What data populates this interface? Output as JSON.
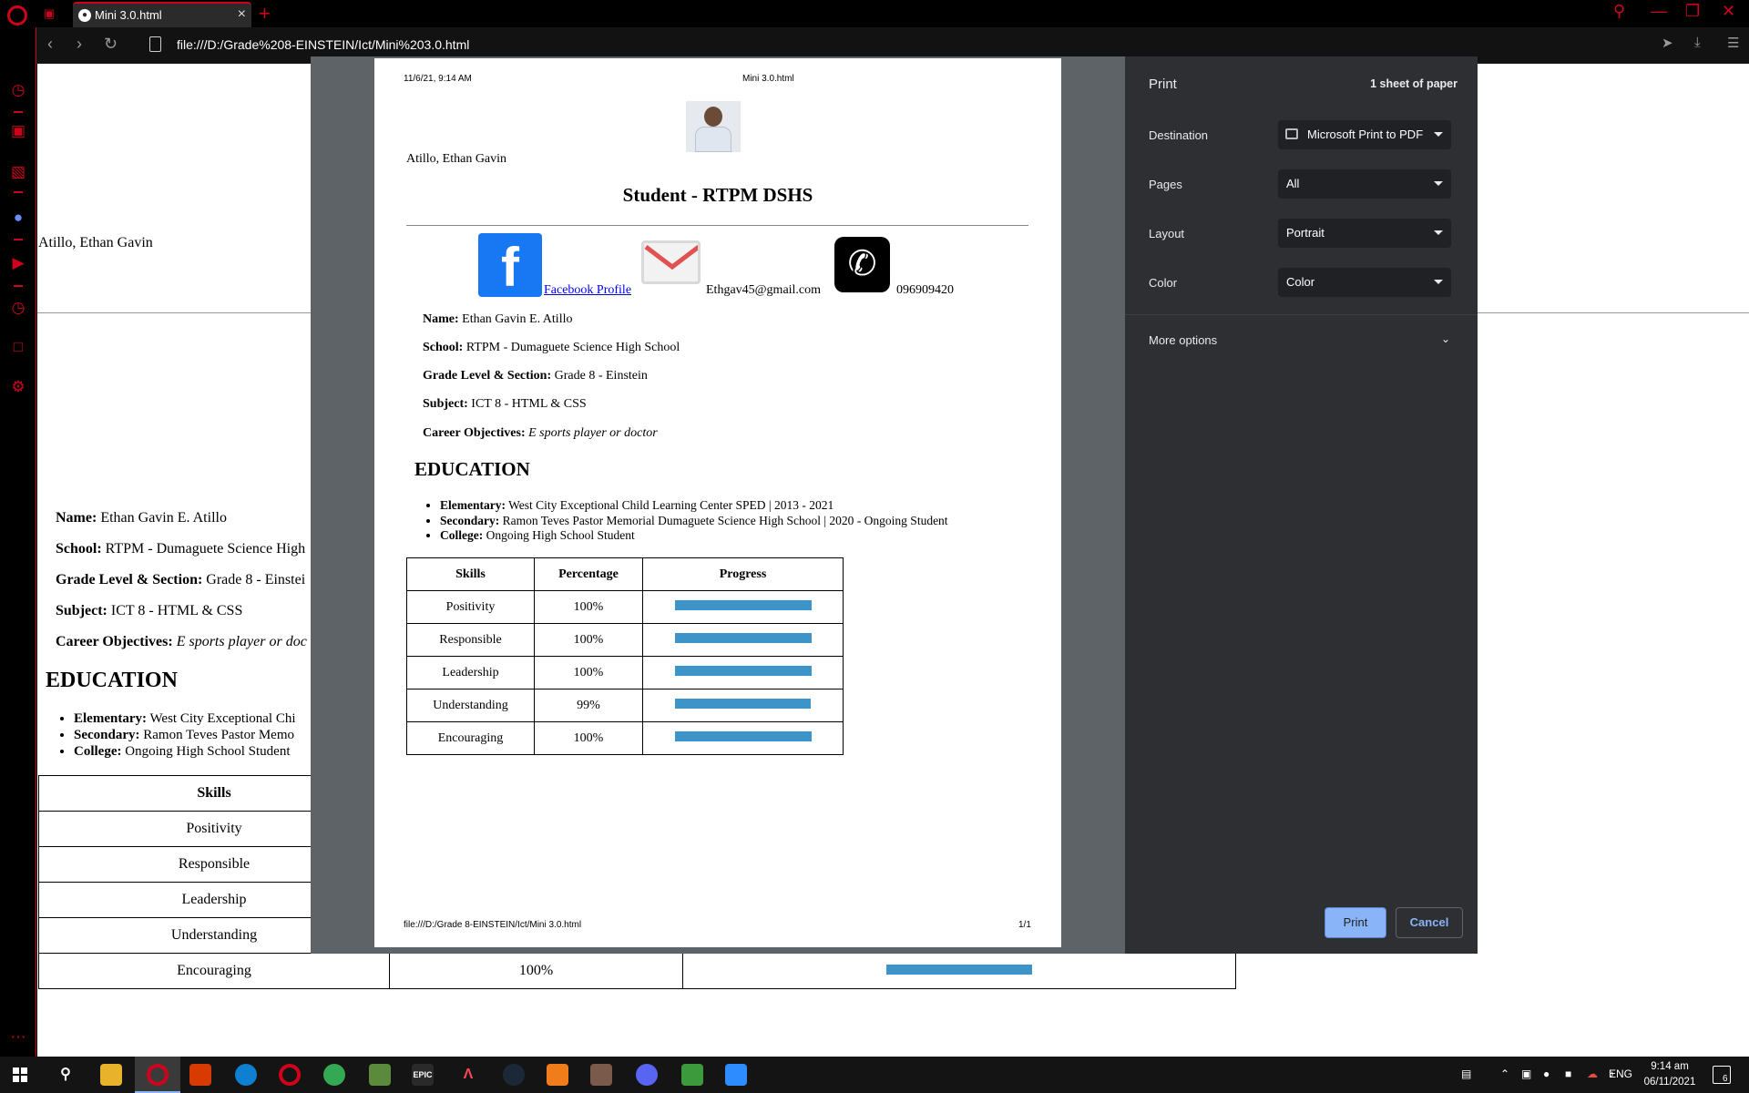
{
  "browser": {
    "tab_title": "Mini 3.0.html",
    "url": "file:///D:/Grade%208-EINSTEIN/Ict/Mini%203.0.html"
  },
  "page": {
    "name_top": "Atillo, Ethan Gavin",
    "info": {
      "name_label": "Name:",
      "name_value": "Ethan Gavin E. Atillo",
      "school_label": "School:",
      "school_value": "RTPM - Dumaguete Science High",
      "grade_label": "Grade Level & Section:",
      "grade_value": "Grade 8 - Einstei",
      "subject_label": "Subject:",
      "subject_value": "ICT 8 - HTML & CSS",
      "career_label": "Career Objectives:",
      "career_value": "E sports player or doc"
    },
    "education_heading": "EDUCATION",
    "education": [
      {
        "label": "Elementary:",
        "value": "West City Exceptional Chi"
      },
      {
        "label": "Secondary:",
        "value": "Ramon Teves Pastor Memo"
      },
      {
        "label": "College:",
        "value": "Ongoing High School Student"
      }
    ],
    "table": {
      "header": "Skills",
      "rows": [
        "Positivity",
        "Responsible",
        "Leadership",
        "Understanding",
        "Encouraging"
      ],
      "last_row_percentage": "100%"
    }
  },
  "preview": {
    "header_datetime": "11/6/21, 9:14 AM",
    "header_title": "Mini 3.0.html",
    "name": "Atillo, Ethan Gavin",
    "heading": "Student - RTPM DSHS",
    "facebook_link": "Facebook Profile",
    "email": "Ethgav45@gmail.com",
    "phone": "096909420",
    "info": {
      "name_label": "Name:",
      "name_value": "Ethan Gavin E. Atillo",
      "school_label": "School:",
      "school_value": "RTPM - Dumaguete Science High School",
      "grade_label": "Grade Level & Section:",
      "grade_value": "Grade 8 - Einstein",
      "subject_label": "Subject:",
      "subject_value": "ICT 8 - HTML & CSS",
      "career_label": "Career Objectives:",
      "career_value": "E sports player or doctor"
    },
    "education_heading": "EDUCATION",
    "education": [
      {
        "label": "Elementary:",
        "value": "West City Exceptional Child Learning Center SPED | 2013 - 2021"
      },
      {
        "label": "Secondary:",
        "value": "Ramon Teves Pastor Memorial Dumaguete Science High School | 2020 - Ongoing Student"
      },
      {
        "label": "College:",
        "value": "Ongoing High School Student"
      }
    ],
    "skills_columns": [
      "Skills",
      "Percentage",
      "Progress"
    ],
    "skills": [
      {
        "skill": "Positivity",
        "percentage": "100%",
        "progress": 1.0
      },
      {
        "skill": "Responsible",
        "percentage": "100%",
        "progress": 1.0
      },
      {
        "skill": "Leadership",
        "percentage": "100%",
        "progress": 1.0
      },
      {
        "skill": "Understanding",
        "percentage": "99%",
        "progress": 0.99
      },
      {
        "skill": "Encouraging",
        "percentage": "100%",
        "progress": 1.0
      }
    ],
    "footer_path": "file:///D:/Grade 8-EINSTEIN/Ict/Mini 3.0.html",
    "footer_page": "1/1"
  },
  "print_panel": {
    "title": "Print",
    "sheets": "1 sheet of paper",
    "destination_label": "Destination",
    "destination_value": "Microsoft Print to PDF",
    "pages_label": "Pages",
    "pages_value": "All",
    "layout_label": "Layout",
    "layout_value": "Portrait",
    "color_label": "Color",
    "color_value": "Color",
    "more_options": "More options",
    "print_button": "Print",
    "cancel_button": "Cancel"
  },
  "taskbar": {
    "language": "ENG",
    "time": "9:14 am",
    "date": "06/11/2021",
    "notification_count": "6",
    "epic_label": "EPIC"
  },
  "colors": {
    "opera_red": "#d0021b",
    "progress_bar": "#3c94c9",
    "print_accent": "#8ab4f8"
  }
}
